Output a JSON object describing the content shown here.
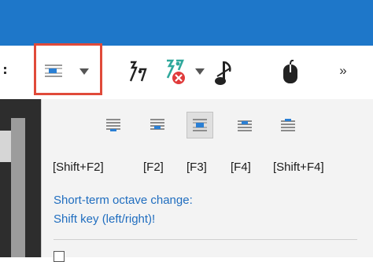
{
  "toolbar": {
    "items": [
      {
        "name": "partial-glyph-icon"
      },
      {
        "name": "octave-mode-icon"
      },
      {
        "name": "dropdown-arrow-icon"
      },
      {
        "name": "tuplet-note-icon"
      },
      {
        "name": "rest-delete-icon"
      },
      {
        "name": "dropdown-arrow-icon"
      },
      {
        "name": "grace-note-icon"
      },
      {
        "name": "mouse-icon"
      },
      {
        "name": "overflow-chevron-icon"
      }
    ],
    "overflow_label": "»"
  },
  "dropdown": {
    "modes": [
      {
        "id": "octave-down-2",
        "selected": false
      },
      {
        "id": "octave-down-1",
        "selected": false
      },
      {
        "id": "octave-normal",
        "selected": true
      },
      {
        "id": "octave-up-1",
        "selected": false
      },
      {
        "id": "octave-up-2",
        "selected": false
      }
    ],
    "shortcuts": [
      "[Shift+F2]",
      "[F2]",
      "[F3]",
      "[F4]",
      "[Shift+F4]"
    ],
    "hint_line1": "Short-term octave change:",
    "hint_line2": "Shift key (left/right)!"
  },
  "colors": {
    "titlebar": "#1e77c9",
    "highlight": "#e04a3a",
    "hint_text": "#1f6dbf",
    "icon_blue": "#2a7fd4"
  }
}
